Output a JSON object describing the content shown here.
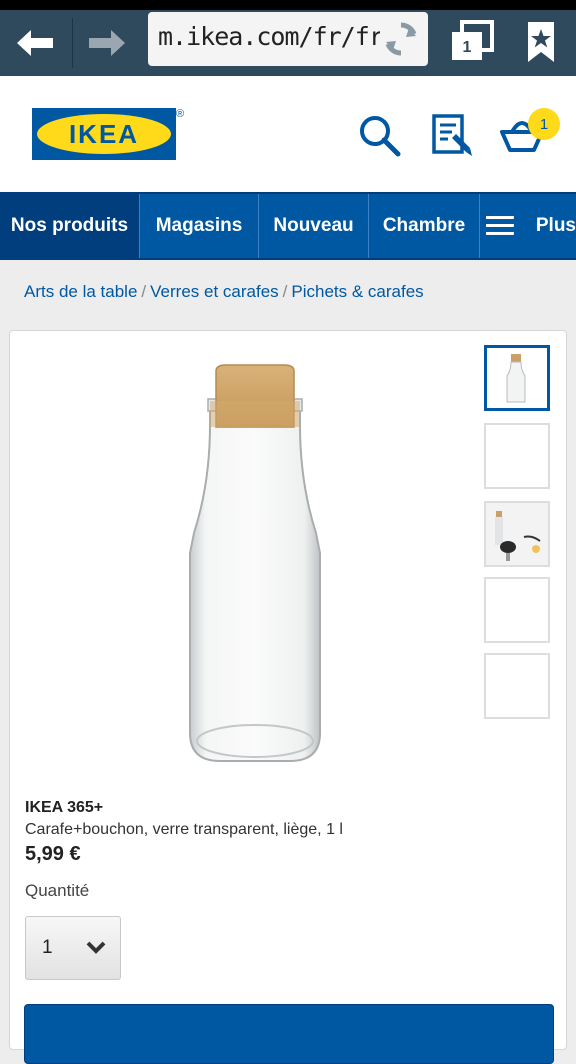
{
  "browser": {
    "url": "m.ikea.com/fr/fr",
    "tab_count": "1"
  },
  "header": {
    "logo_text": "IKEA",
    "logo_reg": "®",
    "cart_count": "1"
  },
  "nav": {
    "items": [
      {
        "label": "Nos produits"
      },
      {
        "label": "Magasins"
      },
      {
        "label": "Nouveau"
      },
      {
        "label": "Chambre"
      },
      {
        "label": "Plus"
      }
    ]
  },
  "breadcrumb": {
    "items": [
      "Arts de la table",
      "Verres et carafes",
      "Pichets & carafes"
    ],
    "separator": "/"
  },
  "product": {
    "name": "IKEA 365+",
    "description": "Carafe+bouchon, verre transparent, liège, 1 l",
    "price": "5,99 €",
    "quantity_label": "Quantité",
    "quantity_value": "1"
  },
  "colors": {
    "ikea_blue": "#0058a3",
    "ikea_yellow": "#ffda1a",
    "browser_bar": "#2e4a5c"
  }
}
